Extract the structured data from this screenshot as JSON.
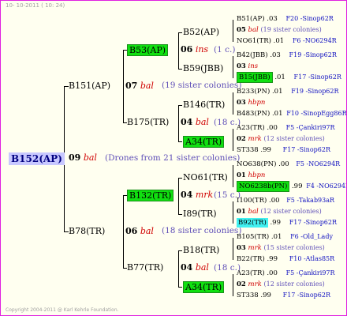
{
  "header": {
    "date": "10- 10-2011 ( 10: 24)"
  },
  "copyright": "Copyright 2004-2011 @ Karl Kehrle Foundation.",
  "root": {
    "name": "B152(AP)",
    "gen": "09",
    "race": "bal",
    "note": "(Drones from 21 sister colonies)"
  },
  "level1": [
    {
      "name": "B151(AP)",
      "gen": "07",
      "race": "bal",
      "note": "(19 sister colonies)"
    },
    {
      "name": "B78(TR)",
      "gen": "06",
      "race": "bal",
      "note": "(18 sister colonies)"
    }
  ],
  "level2": [
    {
      "name": "B53(AP)",
      "gen": "06",
      "race": "ins",
      "note": "(1 c.)"
    },
    {
      "name": "B175(TR)",
      "gen": "04",
      "race": "bal",
      "note": "(18 c.)"
    },
    {
      "name": "B132(TR)",
      "gen": "04",
      "race": "mrk",
      "note": "(15 c.)"
    },
    {
      "name": "B77(TR)",
      "gen": "04",
      "race": "bal",
      "note": "(18 c.)"
    }
  ],
  "level3": [
    {
      "name": "B52(AP)"
    },
    {
      "name": "B59(JBB)"
    },
    {
      "name": "B146(TR)"
    },
    {
      "name": "A34(TR)"
    },
    {
      "name": "NO61(TR)"
    },
    {
      "name": "I89(TR)"
    },
    {
      "name": "B18(TR)"
    },
    {
      "name": "A34(TR)"
    }
  ],
  "level4": [
    {
      "top": {
        "name": "B51(AP)",
        "score": ".03",
        "ref": "F20 -Sinop62R"
      },
      "gen": "05",
      "race": "bal",
      "note": "(19 sister colonies)",
      "bottom": {
        "name": "NO61(TR)",
        "score": ".01",
        "ref": "F6 -NO6294R"
      }
    },
    {
      "top": {
        "name": "B42(JBB)",
        "score": ".03",
        "ref": "F19 -Sinop62R"
      },
      "gen": "03",
      "race": "ins",
      "note": "",
      "bottom": {
        "name": "B15(JBB)",
        "score": ".01",
        "ref": "F17 -Sinop62R"
      }
    },
    {
      "top": {
        "name": "B233(PN)",
        "score": ".01",
        "ref": "F19 -Sinop62R"
      },
      "gen": "03",
      "race": "hbpn",
      "note": "",
      "bottom": {
        "name": "B483(PN)",
        "score": ".01",
        "ref": "F10 -SinopEgg86R"
      }
    },
    {
      "top": {
        "name": "A23(TR)",
        "score": ".00",
        "ref": "F5 -Çankiri97R"
      },
      "gen": "02",
      "race": "mrk",
      "note": "(12 sister colonies)",
      "bottom": {
        "name": "ST338",
        "score": ".99",
        "ref": "F17 -Sinop62R"
      }
    },
    {
      "top": {
        "name": "NO638(PN)",
        "score": ".00",
        "ref": "F5 -NO6294R"
      },
      "gen": "01",
      "race": "hbpn",
      "note": "",
      "bottom": {
        "name": "NO6238b(PN)",
        "score": ".99",
        "ref": "F4 -NO6294R"
      }
    },
    {
      "top": {
        "name": "I100(TR)",
        "score": ".00",
        "ref": "F5 -Takab93aR"
      },
      "gen": "01",
      "race": "bal",
      "note": "(12 sister colonies)",
      "bottom": {
        "name": "B92(TR)",
        "score": ".99",
        "ref": "F17 -Sinop62R"
      }
    },
    {
      "top": {
        "name": "B105(TR)",
        "score": ".01",
        "ref": "F6 -Old_Lady"
      },
      "gen": "03",
      "race": "mrk",
      "note": "(15 sister colonies)",
      "bottom": {
        "name": "B22(TR)",
        "score": ".99",
        "ref": "F10 -Atlas85R"
      }
    },
    {
      "top": {
        "name": "A23(TR)",
        "score": ".00",
        "ref": "F5 -Çankiri97R"
      },
      "gen": "02",
      "race": "mrk",
      "note": "(12 sister colonies)",
      "bottom": {
        "name": "ST338",
        "score": ".99",
        "ref": "F17 -Sinop62R"
      }
    }
  ]
}
